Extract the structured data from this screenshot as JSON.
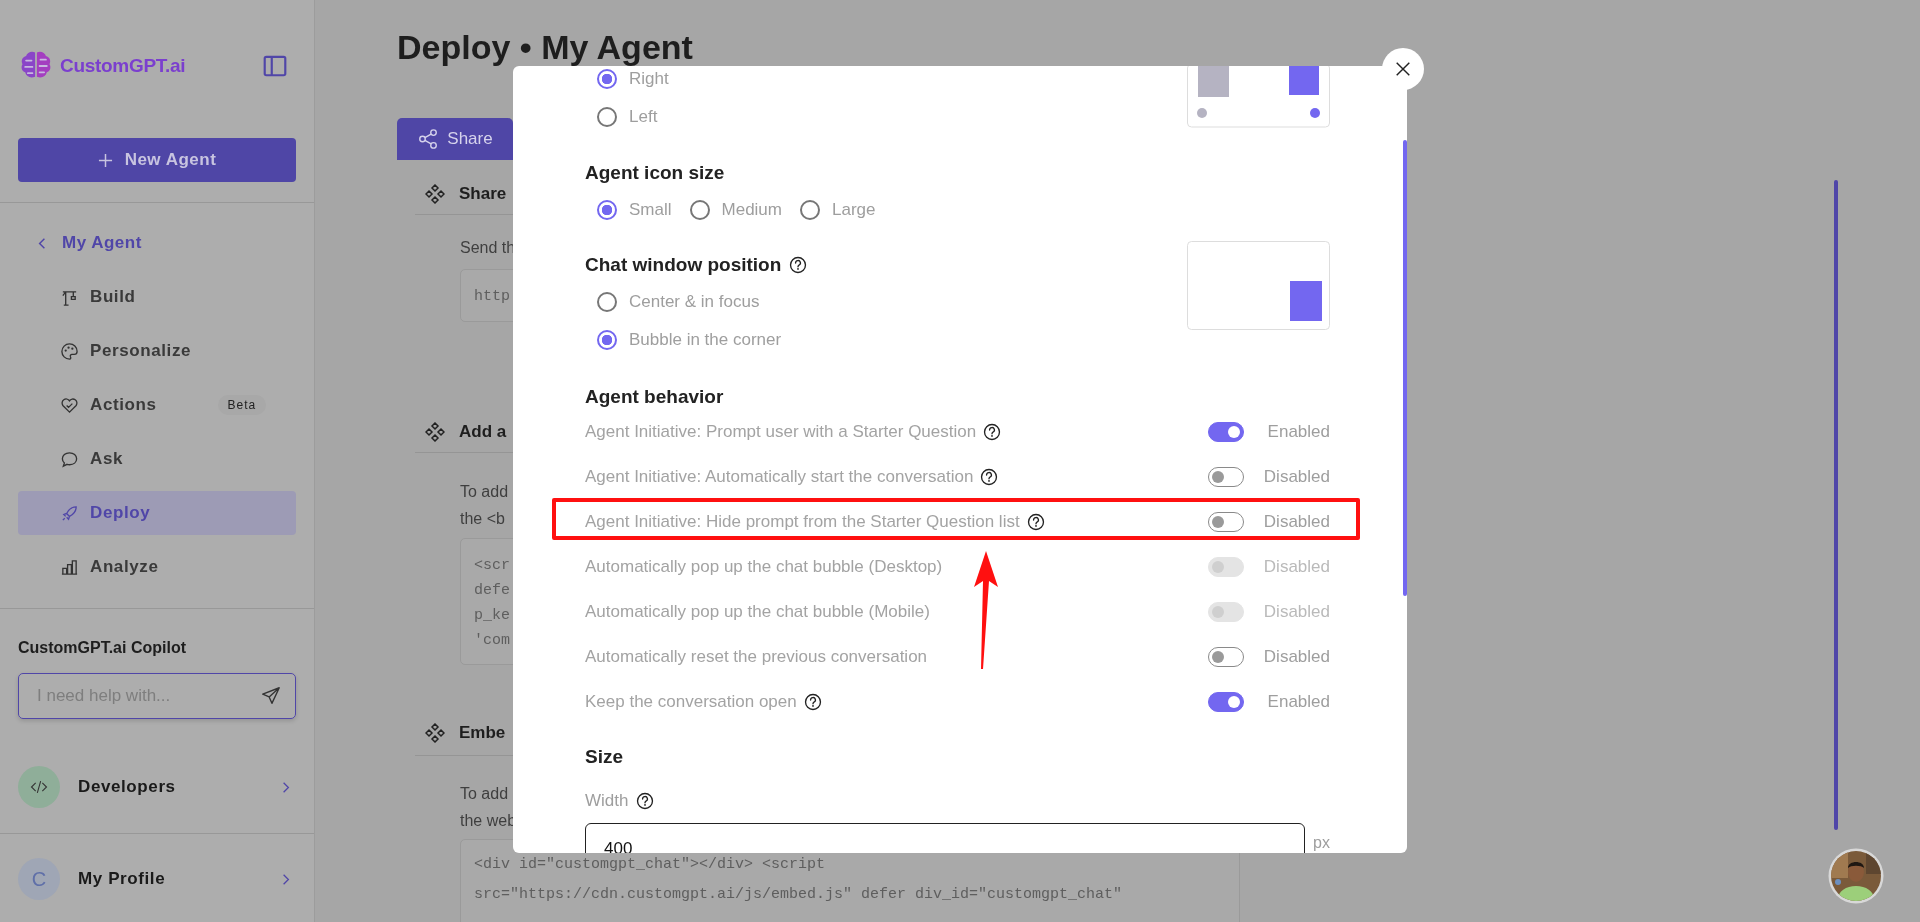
{
  "sidebar": {
    "logo": "CustomGPT.ai",
    "new_agent_button": "New Agent",
    "back_item": "My Agent",
    "nav_items": [
      {
        "label": "Build",
        "selected": false
      },
      {
        "label": "Personalize",
        "selected": false
      },
      {
        "label": "Actions",
        "selected": false,
        "badge": "Beta"
      },
      {
        "label": "Ask",
        "selected": false
      },
      {
        "label": "Deploy",
        "selected": true
      },
      {
        "label": "Analyze",
        "selected": false
      }
    ],
    "copilot": {
      "title": "CustomGPT.ai Copilot",
      "placeholder": "I need help with..."
    },
    "links": [
      {
        "label": "Developers",
        "kind": "code"
      },
      {
        "label": "My Profile",
        "kind": "letter",
        "avatar_letter": "C"
      }
    ]
  },
  "page": {
    "title": "Deploy • My Agent",
    "tabs": [
      {
        "label": "Share",
        "selected": true
      }
    ],
    "sections": [
      {
        "heading": "Share",
        "lines": [
          "Send th"
        ],
        "code": [
          "http"
        ]
      },
      {
        "heading": "Add a",
        "lines": [
          "To add",
          "the <b"
        ],
        "code": [
          "<scr",
          "defe",
          "p_ke",
          "'com"
        ]
      },
      {
        "heading": "Embe",
        "lines": [
          "To add",
          "the web"
        ],
        "code": [
          "<div id=\"customgpt_chat\"></div> <script",
          "src=\"https://cdn.customgpt.ai/js/embed.js\" defer div_id=\"customgpt_chat\""
        ]
      }
    ]
  },
  "modal": {
    "position_options": [
      {
        "label": "Right",
        "selected": true
      },
      {
        "label": "Left",
        "selected": false
      }
    ],
    "icon_size": {
      "heading": "Agent icon size",
      "options": [
        {
          "label": "Small",
          "selected": true
        },
        {
          "label": "Medium",
          "selected": false
        },
        {
          "label": "Large",
          "selected": false
        }
      ]
    },
    "chat_window_position": {
      "heading": "Chat window position",
      "help": true,
      "options": [
        {
          "label": "Center & in focus",
          "selected": false
        },
        {
          "label": "Bubble in the corner",
          "selected": true
        }
      ]
    },
    "behavior": {
      "heading": "Agent behavior",
      "rows": [
        {
          "label": "Agent Initiative: Prompt user with a Starter Question",
          "help": true,
          "on": true,
          "disabled": false,
          "status": "Enabled",
          "highlighted": false
        },
        {
          "label": "Agent Initiative: Automatically start the conversation",
          "help": true,
          "on": false,
          "disabled": false,
          "status": "Disabled",
          "highlighted": false
        },
        {
          "label": "Agent Initiative: Hide prompt from the Starter Question list",
          "help": true,
          "on": false,
          "disabled": false,
          "status": "Disabled",
          "highlighted": true
        },
        {
          "label": "Automatically pop up the chat bubble (Desktop)",
          "help": false,
          "on": false,
          "disabled": true,
          "status": "Disabled",
          "highlighted": false
        },
        {
          "label": "Automatically pop up the chat bubble (Mobile)",
          "help": false,
          "on": false,
          "disabled": true,
          "status": "Disabled",
          "highlighted": false
        },
        {
          "label": "Automatically reset the previous conversation",
          "help": false,
          "on": false,
          "disabled": false,
          "status": "Disabled",
          "highlighted": false
        },
        {
          "label": "Keep the conversation open",
          "help": true,
          "on": true,
          "disabled": false,
          "status": "Enabled",
          "highlighted": false
        }
      ]
    },
    "size": {
      "heading": "Size",
      "width_label": "Width",
      "width_help": true,
      "width_value": "400",
      "unit": "px"
    }
  }
}
